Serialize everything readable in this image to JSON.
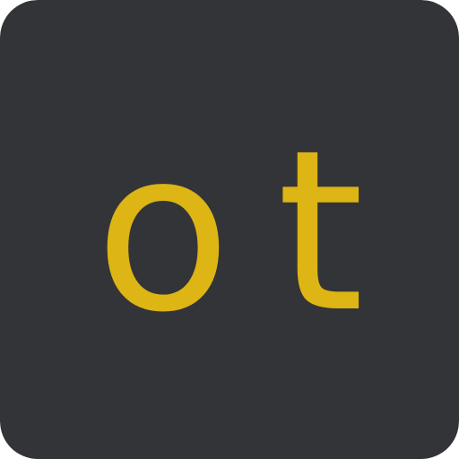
{
  "icon": {
    "name": "ot-app-icon",
    "text": "ot",
    "background_color": "#333438",
    "text_color": "#DDB514"
  }
}
